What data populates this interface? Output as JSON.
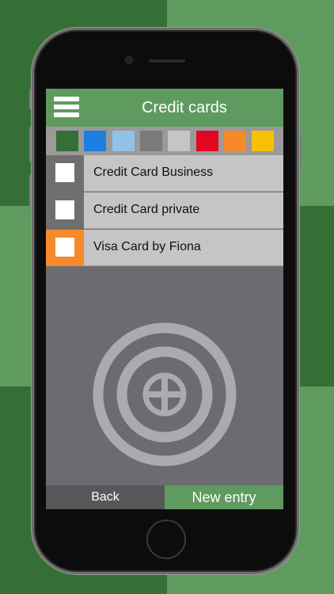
{
  "header": {
    "title": "Credit cards",
    "menu_icon": "cards-stack-icon"
  },
  "color_swatches": [
    {
      "name": "dark-green",
      "color": "#356f35"
    },
    {
      "name": "blue",
      "color": "#1e7fe0"
    },
    {
      "name": "light-blue",
      "color": "#90c2ea"
    },
    {
      "name": "gray",
      "color": "#7a7a7a"
    },
    {
      "name": "light-gray",
      "color": "#c5c5c5"
    },
    {
      "name": "red",
      "color": "#e40520"
    },
    {
      "name": "orange",
      "color": "#f6892a"
    },
    {
      "name": "yellow",
      "color": "#f6c104"
    }
  ],
  "entries": [
    {
      "label": "Credit Card Business",
      "color": "#6f6f6f"
    },
    {
      "label": "Credit Card private",
      "color": "#6f6f6f"
    },
    {
      "label": "Visa Card by Fiona",
      "color": "#f6892a"
    }
  ],
  "content": {
    "add_icon": "add-circle-icon"
  },
  "bottom_bar": {
    "back_label": "Back",
    "new_entry_label": "New entry"
  },
  "colors": {
    "accent_green": "#5f9a5f",
    "row_background": "#c5c5c5",
    "content_background": "#6a6c70"
  }
}
